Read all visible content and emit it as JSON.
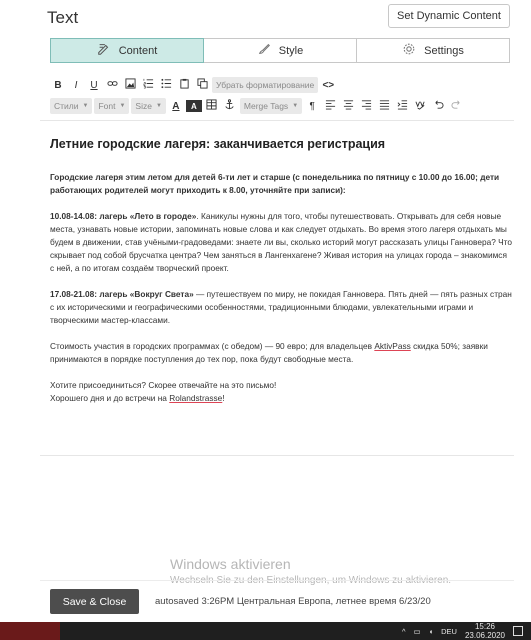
{
  "header": {
    "title": "Text",
    "dynamic_button": "Set Dynamic Content"
  },
  "tabs": [
    {
      "label": "Content",
      "icon": "pencil-icon",
      "active": true
    },
    {
      "label": "Style",
      "icon": "brush-icon",
      "active": false
    },
    {
      "label": "Settings",
      "icon": "gear-icon",
      "active": false
    }
  ],
  "toolbar": {
    "bold": "B",
    "italic": "I",
    "underline": "U",
    "clear_format": "Убрать форматирование",
    "source": "<>",
    "styles": "Стили",
    "font": "Font",
    "size": "Size",
    "text_color": "A",
    "bg_color": "A",
    "merge_tags": "Merge Tags",
    "paragraph": "¶"
  },
  "editor": {
    "heading": "Летние городские лагеря: заканчивается регистрация",
    "intro": "Городские лагеря этим летом для детей 6-ти лет и старше (с понедельника по пятницу с 10.00 до 16.00; дети работающих родителей могут приходить к 8.00, уточняйте при записи):",
    "p1_bold": "10.08-14.08: лагерь «Лето в городе»",
    "p1_text": ". Каникулы нужны для того, чтобы путешествовать. Открывать для себя новые места, узнавать новые истории, запоминать новые слова и как следует отдыхать. Во время этого лагеря отдыхать мы будем в движении, став учёными-градоведами: знаете ли вы, сколько историй могут рассказать улицы Ганновера? Что скрывает под собой брусчатка центра? Чем заняться в Лангенхагене? Живая история на улицах города – знакомимся с ней, а по итогам создаём творческий проект.",
    "p2_bold": "17.08-21.08: лагерь «Вокруг Света»",
    "p2_text": " — путешествуем по миру, не покидая Ганновера. Пять дней — пять разных стран с их историческими и географическими особенностями, традиционными блюдами, увлекательными играми и творческими мастер-классами.",
    "p3_before": "Стоимость участия в городских программах (с обедом) — 90 евро; для владельцев ",
    "p3_link": "AktivPass",
    "p3_after": " скидка 50%; заявки принимаются в порядке поступления до тех пор, пока будут свободные места.",
    "p4_line1": "Хотите присоединиться? Скорее отвечайте на это письмо!",
    "p4_before": "Хорошего дня и до встречи на ",
    "p4_link": "Rolandstrasse",
    "p4_after": "!"
  },
  "watermark": {
    "title": "Windows aktivieren",
    "subtitle": "Wechseln Sie zu den Einstellungen, um Windows zu aktivieren."
  },
  "footer": {
    "save_label": "Save & Close",
    "autosave": "autosaved 3:26PM Центральная Европа, летнее время 6/23/20"
  },
  "taskbar": {
    "lang": "DEU",
    "time": "15:26",
    "date": "23.06.2020"
  }
}
